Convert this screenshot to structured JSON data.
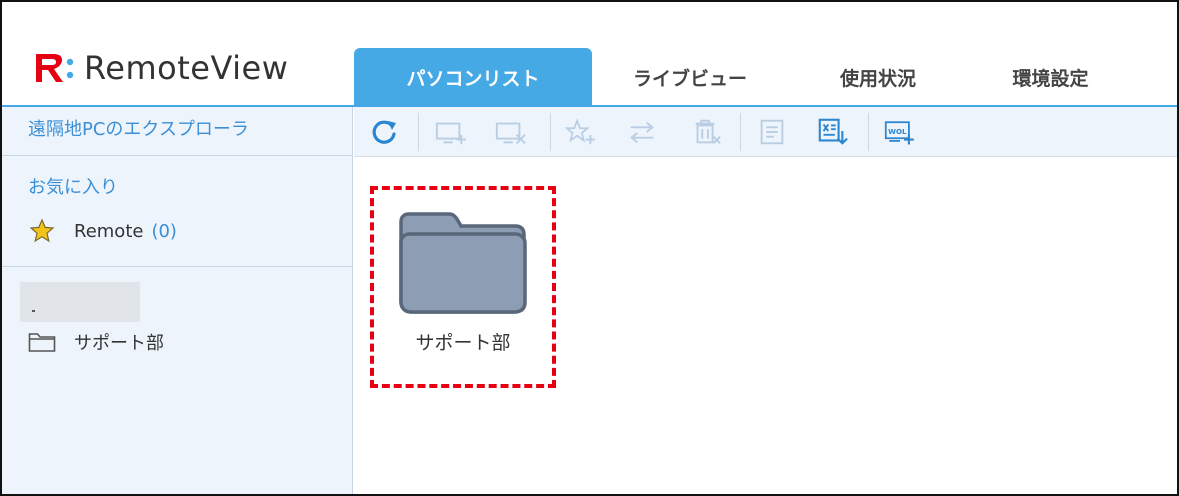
{
  "app": {
    "logo_text": "RemoteView",
    "logo_mark": "R",
    "brand_color": "#e60012",
    "accent_color": "#45a9e6"
  },
  "tabs": [
    {
      "label": "パソコンリスト",
      "active": true
    },
    {
      "label": "ライブビュー",
      "active": false
    },
    {
      "label": "使用状況",
      "active": false
    },
    {
      "label": "環境設定",
      "active": false
    }
  ],
  "sidebar": {
    "explorer_label": "遠隔地PCのエクスプローラ",
    "favorites_heading": "お気に入り",
    "favorites": [
      {
        "label": "Remote",
        "count": "(0)",
        "icon": "star-icon"
      }
    ],
    "folders": [
      {
        "label": "サポート部",
        "icon": "folder-outline-icon"
      }
    ]
  },
  "toolbar": {
    "buttons": [
      {
        "name": "refresh-icon",
        "enabled": true
      },
      {
        "name": "add-pc-icon",
        "enabled": false
      },
      {
        "name": "remove-pc-icon",
        "enabled": false
      },
      {
        "name": "add-favorite-icon",
        "enabled": false
      },
      {
        "name": "move-icon",
        "enabled": false
      },
      {
        "name": "delete-icon",
        "enabled": false
      },
      {
        "name": "memo-icon",
        "enabled": false
      },
      {
        "name": "export-icon",
        "enabled": true
      },
      {
        "name": "wol-icon",
        "enabled": true
      }
    ],
    "wol_text": "WOL"
  },
  "main": {
    "items": [
      {
        "label": "サポート部",
        "icon": "folder-icon",
        "highlighted": true
      }
    ],
    "highlight_color": "#e60012"
  }
}
